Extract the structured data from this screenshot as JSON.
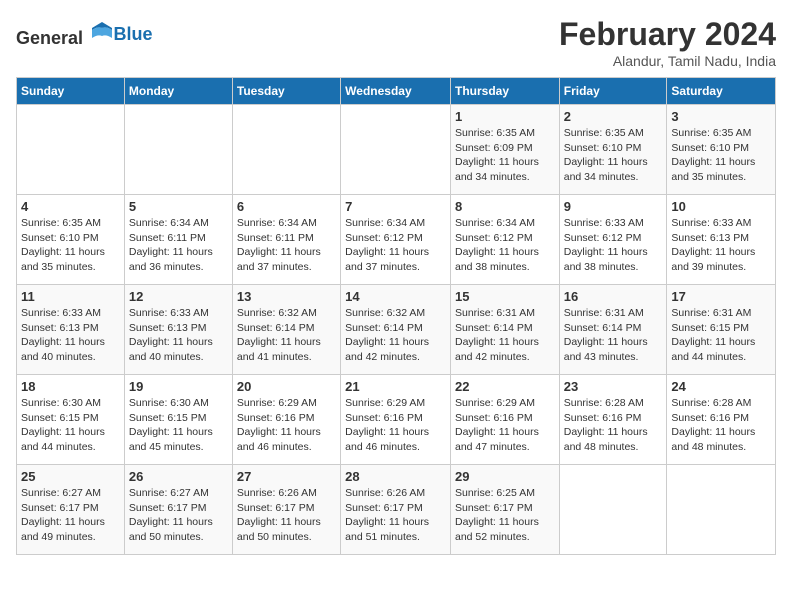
{
  "header": {
    "logo_general": "General",
    "logo_blue": "Blue",
    "month_year": "February 2024",
    "location": "Alandur, Tamil Nadu, India"
  },
  "days_of_week": [
    "Sunday",
    "Monday",
    "Tuesday",
    "Wednesday",
    "Thursday",
    "Friday",
    "Saturday"
  ],
  "weeks": [
    [
      {
        "day": "",
        "info": ""
      },
      {
        "day": "",
        "info": ""
      },
      {
        "day": "",
        "info": ""
      },
      {
        "day": "",
        "info": ""
      },
      {
        "day": "1",
        "info": "Sunrise: 6:35 AM\nSunset: 6:09 PM\nDaylight: 11 hours\nand 34 minutes."
      },
      {
        "day": "2",
        "info": "Sunrise: 6:35 AM\nSunset: 6:10 PM\nDaylight: 11 hours\nand 34 minutes."
      },
      {
        "day": "3",
        "info": "Sunrise: 6:35 AM\nSunset: 6:10 PM\nDaylight: 11 hours\nand 35 minutes."
      }
    ],
    [
      {
        "day": "4",
        "info": "Sunrise: 6:35 AM\nSunset: 6:10 PM\nDaylight: 11 hours\nand 35 minutes."
      },
      {
        "day": "5",
        "info": "Sunrise: 6:34 AM\nSunset: 6:11 PM\nDaylight: 11 hours\nand 36 minutes."
      },
      {
        "day": "6",
        "info": "Sunrise: 6:34 AM\nSunset: 6:11 PM\nDaylight: 11 hours\nand 37 minutes."
      },
      {
        "day": "7",
        "info": "Sunrise: 6:34 AM\nSunset: 6:12 PM\nDaylight: 11 hours\nand 37 minutes."
      },
      {
        "day": "8",
        "info": "Sunrise: 6:34 AM\nSunset: 6:12 PM\nDaylight: 11 hours\nand 38 minutes."
      },
      {
        "day": "9",
        "info": "Sunrise: 6:33 AM\nSunset: 6:12 PM\nDaylight: 11 hours\nand 38 minutes."
      },
      {
        "day": "10",
        "info": "Sunrise: 6:33 AM\nSunset: 6:13 PM\nDaylight: 11 hours\nand 39 minutes."
      }
    ],
    [
      {
        "day": "11",
        "info": "Sunrise: 6:33 AM\nSunset: 6:13 PM\nDaylight: 11 hours\nand 40 minutes."
      },
      {
        "day": "12",
        "info": "Sunrise: 6:33 AM\nSunset: 6:13 PM\nDaylight: 11 hours\nand 40 minutes."
      },
      {
        "day": "13",
        "info": "Sunrise: 6:32 AM\nSunset: 6:14 PM\nDaylight: 11 hours\nand 41 minutes."
      },
      {
        "day": "14",
        "info": "Sunrise: 6:32 AM\nSunset: 6:14 PM\nDaylight: 11 hours\nand 42 minutes."
      },
      {
        "day": "15",
        "info": "Sunrise: 6:31 AM\nSunset: 6:14 PM\nDaylight: 11 hours\nand 42 minutes."
      },
      {
        "day": "16",
        "info": "Sunrise: 6:31 AM\nSunset: 6:14 PM\nDaylight: 11 hours\nand 43 minutes."
      },
      {
        "day": "17",
        "info": "Sunrise: 6:31 AM\nSunset: 6:15 PM\nDaylight: 11 hours\nand 44 minutes."
      }
    ],
    [
      {
        "day": "18",
        "info": "Sunrise: 6:30 AM\nSunset: 6:15 PM\nDaylight: 11 hours\nand 44 minutes."
      },
      {
        "day": "19",
        "info": "Sunrise: 6:30 AM\nSunset: 6:15 PM\nDaylight: 11 hours\nand 45 minutes."
      },
      {
        "day": "20",
        "info": "Sunrise: 6:29 AM\nSunset: 6:16 PM\nDaylight: 11 hours\nand 46 minutes."
      },
      {
        "day": "21",
        "info": "Sunrise: 6:29 AM\nSunset: 6:16 PM\nDaylight: 11 hours\nand 46 minutes."
      },
      {
        "day": "22",
        "info": "Sunrise: 6:29 AM\nSunset: 6:16 PM\nDaylight: 11 hours\nand 47 minutes."
      },
      {
        "day": "23",
        "info": "Sunrise: 6:28 AM\nSunset: 6:16 PM\nDaylight: 11 hours\nand 48 minutes."
      },
      {
        "day": "24",
        "info": "Sunrise: 6:28 AM\nSunset: 6:16 PM\nDaylight: 11 hours\nand 48 minutes."
      }
    ],
    [
      {
        "day": "25",
        "info": "Sunrise: 6:27 AM\nSunset: 6:17 PM\nDaylight: 11 hours\nand 49 minutes."
      },
      {
        "day": "26",
        "info": "Sunrise: 6:27 AM\nSunset: 6:17 PM\nDaylight: 11 hours\nand 50 minutes."
      },
      {
        "day": "27",
        "info": "Sunrise: 6:26 AM\nSunset: 6:17 PM\nDaylight: 11 hours\nand 50 minutes."
      },
      {
        "day": "28",
        "info": "Sunrise: 6:26 AM\nSunset: 6:17 PM\nDaylight: 11 hours\nand 51 minutes."
      },
      {
        "day": "29",
        "info": "Sunrise: 6:25 AM\nSunset: 6:17 PM\nDaylight: 11 hours\nand 52 minutes."
      },
      {
        "day": "",
        "info": ""
      },
      {
        "day": "",
        "info": ""
      }
    ]
  ]
}
